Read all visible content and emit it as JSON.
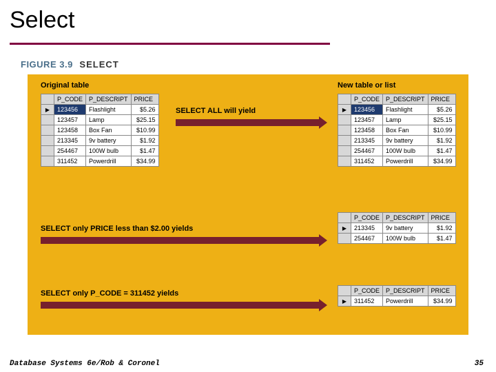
{
  "slide": {
    "title": "Select"
  },
  "figure": {
    "number_label": "FIGURE 3.9",
    "title": "SELECT"
  },
  "panel": {
    "original_label": "Original table",
    "newlist_label": "New table or list",
    "select_all_label": "SELECT ALL will yield",
    "select_price_label": "SELECT only PRICE less than $2.00 yields",
    "select_pcode_label": "SELECT only P_CODE = 311452 yields"
  },
  "columns": {
    "pcode": "P_CODE",
    "pdesc": "P_DESCRIPT",
    "price": "PRICE"
  },
  "tables": {
    "original": [
      {
        "pcode": "123456",
        "pdesc": "Flashlight",
        "price": "$5.26",
        "selected": true,
        "marker": "▶"
      },
      {
        "pcode": "123457",
        "pdesc": "Lamp",
        "price": "$25.15"
      },
      {
        "pcode": "123458",
        "pdesc": "Box Fan",
        "price": "$10.99"
      },
      {
        "pcode": "213345",
        "pdesc": "9v battery",
        "price": "$1.92"
      },
      {
        "pcode": "254467",
        "pdesc": "100W bulb",
        "price": "$1.47"
      },
      {
        "pcode": "311452",
        "pdesc": "Powerdrill",
        "price": "$34.99"
      }
    ],
    "result_all": [
      {
        "pcode": "123456",
        "pdesc": "Flashlight",
        "price": "$5.26",
        "selected": true,
        "marker": "▶"
      },
      {
        "pcode": "123457",
        "pdesc": "Lamp",
        "price": "$25.15"
      },
      {
        "pcode": "123458",
        "pdesc": "Box Fan",
        "price": "$10.99"
      },
      {
        "pcode": "213345",
        "pdesc": "9v battery",
        "price": "$1.92"
      },
      {
        "pcode": "254467",
        "pdesc": "100W bulb",
        "price": "$1.47"
      },
      {
        "pcode": "311452",
        "pdesc": "Powerdrill",
        "price": "$34.99"
      }
    ],
    "result_price": [
      {
        "pcode": "213345",
        "pdesc": "9v battery",
        "price": "$1.92",
        "marker": "▶"
      },
      {
        "pcode": "254467",
        "pdesc": "100W bulb",
        "price": "$1.47"
      }
    ],
    "result_pcode": [
      {
        "pcode": "311452",
        "pdesc": "Powerdrill",
        "price": "$34.99",
        "marker": "▶"
      }
    ]
  },
  "footer": {
    "text": "Database Systems 6e/Rob & Coronel",
    "page": "35"
  }
}
